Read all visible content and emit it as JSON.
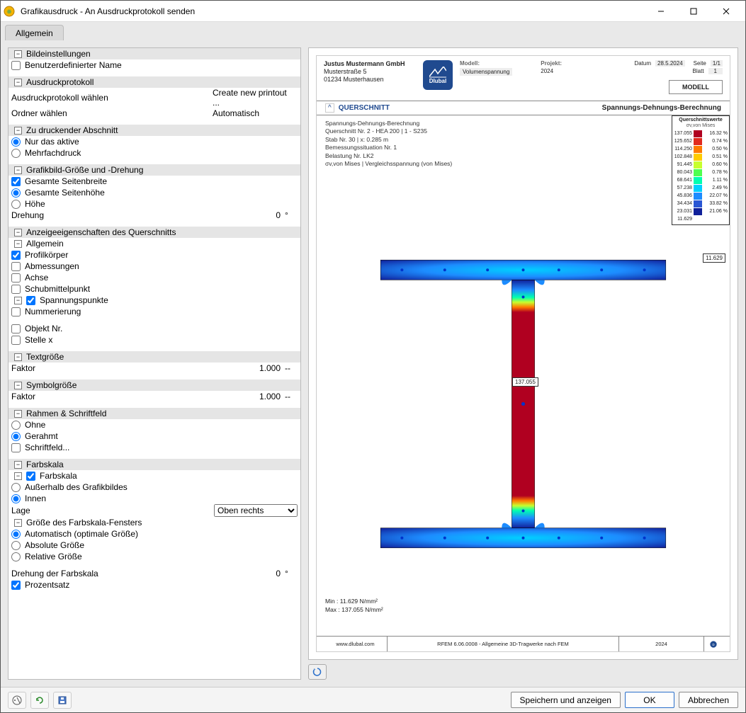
{
  "window": {
    "title": "Grafikausdruck - An Ausdruckprotokoll senden"
  },
  "tabs": {
    "general": "Allgemein"
  },
  "sections": {
    "bild": "Bildeinstellungen",
    "bild_custom_name": "Benutzerdefinierter Name",
    "proto": "Ausdruckprotokoll",
    "proto_choose": "Ausdruckprotokoll wählen",
    "proto_choose_val": "Create new printout ...",
    "proto_folder": "Ordner wählen",
    "proto_folder_val": "Automatisch",
    "print_sec": "Zu druckender Abschnitt",
    "print_active": "Nur das aktive",
    "print_multi": "Mehrfachdruck",
    "gfx": "Grafikbild-Größe und -Drehung",
    "gfx_fullw": "Gesamte Seitenbreite",
    "gfx_fullh": "Gesamte Seitenhöhe",
    "gfx_h": "Höhe",
    "gfx_rot": "Drehung",
    "gfx_rot_val": "0",
    "gfx_rot_unit": "°",
    "disp": "Anzeigeeigenschaften des Querschnitts",
    "disp_general": "Allgemein",
    "disp_body": "Profilkörper",
    "disp_dim": "Abmessungen",
    "disp_axis": "Achse",
    "disp_shear": "Schubmittelpunkt",
    "disp_sp": "Spannungspunkte",
    "disp_num": "Nummerierung",
    "disp_obj": "Objekt Nr.",
    "disp_x": "Stelle x",
    "text": "Textgröße",
    "text_factor": "Faktor",
    "text_val": "1.000",
    "text_unit": "--",
    "sym": "Symbolgröße",
    "sym_factor": "Faktor",
    "sym_val": "1.000",
    "sym_unit": "--",
    "frame": "Rahmen & Schriftfeld",
    "frame_none": "Ohne",
    "frame_framed": "Gerahmt",
    "frame_schrift": "Schriftfeld...",
    "color": "Farbskala",
    "color_cb": "Farbskala",
    "color_out": "Außerhalb des Grafikbildes",
    "color_in": "Innen",
    "color_pos": "Lage",
    "color_pos_val": "Oben rechts",
    "color_size": "Größe des Farbskala-Fensters",
    "color_auto": "Automatisch (optimale Größe)",
    "color_abs": "Absolute Größe",
    "color_rel": "Relative Größe",
    "color_rot": "Drehung der Farbskala",
    "color_rot_val": "0",
    "color_rot_unit": "°",
    "color_pct": "Prozentsatz"
  },
  "preview": {
    "addr1": "Justus Mustermann GmbH",
    "addr2": "Musterstraße 5",
    "addr3": "01234 Musterhausen",
    "logo": "Dlubal",
    "model_lbl": "Modell:",
    "model_val": "Volumenspannung",
    "project_lbl": "Projekt:",
    "project_val": "2024",
    "date_lbl": "Datum",
    "date_val": "28.5.2024",
    "page_lbl": "Seite",
    "page_val": "1/1",
    "sheet_lbl": "Blatt",
    "sheet_val": "1",
    "model_box": "MODELL",
    "sub_left_marker": "^",
    "sub_left": "QUERSCHNITT",
    "sub_right": "Spannungs-Dehnungs-Berechnung",
    "meta": [
      "Spannungs-Dehnungs-Berechnung",
      "Querschnitt Nr. 2 - HEA 200 | 1 - S235",
      "Stab Nr. 30 | x: 0.285 m",
      "Bemessungssituation Nr. 1",
      "Belastung Nr. LK2",
      "σv,von Mises | Vergleichsspannung (von Mises)"
    ],
    "legend_title": "Querschnittswerte",
    "legend_sub": "σv,von Mises",
    "legend": [
      {
        "v": "137.055",
        "c": "#b00020",
        "p": "16.32 %"
      },
      {
        "v": "125.652",
        "c": "#e12a1f",
        "p": "0.74 %"
      },
      {
        "v": "114.250",
        "c": "#ff7a00",
        "p": "0.50 %"
      },
      {
        "v": "102.848",
        "c": "#ffcc00",
        "p": "0.51 %"
      },
      {
        "v": "91.445",
        "c": "#c7ff2e",
        "p": "0.60 %"
      },
      {
        "v": "80.043",
        "c": "#4fff4f",
        "p": "0.78 %"
      },
      {
        "v": "68.641",
        "c": "#00ffb0",
        "p": "1.11 %"
      },
      {
        "v": "57.238",
        "c": "#00d0ff",
        "p": "2.49 %"
      },
      {
        "v": "45.836",
        "c": "#1d8cff",
        "p": "22.07 %"
      },
      {
        "v": "34.434",
        "c": "#2a56d4",
        "p": "33.82 %"
      },
      {
        "v": "23.031",
        "c": "#10209a",
        "p": "21.06 %"
      },
      {
        "v": "11.629",
        "c": "",
        "p": ""
      }
    ],
    "callout_top": "11.629",
    "callout_mid": "137.055",
    "min_lbl": "Min :",
    "min_val": "11.629 N/mm²",
    "max_lbl": "Max :",
    "max_val": "137.055 N/mm²",
    "footer_url": "www.dlubal.com",
    "footer_mid": "RFEM 6.06.0008 - Allgemeine 3D-Tragwerke nach FEM",
    "footer_right": "2024"
  },
  "buttons": {
    "save_show": "Speichern und anzeigen",
    "ok": "OK",
    "cancel": "Abbrechen"
  }
}
